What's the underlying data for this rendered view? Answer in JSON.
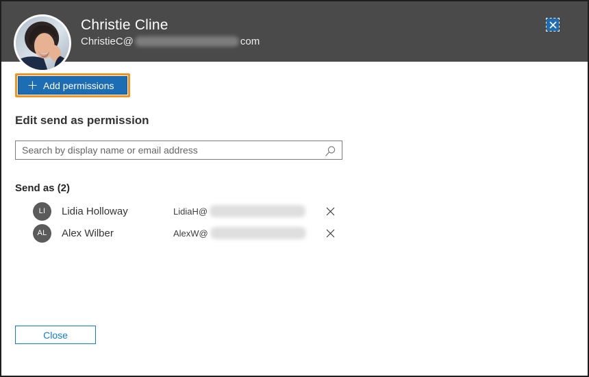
{
  "header": {
    "name": "Christie Cline",
    "email_prefix": "ChristieC@",
    "email_suffix": "com",
    "avatar_alt": "christie-cline-photo",
    "close_icon": "close-x"
  },
  "toolbar": {
    "add_permissions_label": "Add permissions",
    "plus_icon": "plus",
    "highlight_color": "#f2941f",
    "button_color": "#1d6db4"
  },
  "section": {
    "title": "Edit send as permission"
  },
  "search": {
    "placeholder": "Search by display name or email address",
    "icon": "magnifier"
  },
  "list": {
    "title": "Send as (2)",
    "rows": [
      {
        "initials": "LI",
        "name": "Lidia Holloway",
        "email_prefix": "LidiaH@",
        "remove_icon": "close-x"
      },
      {
        "initials": "AL",
        "name": "Alex Wilber",
        "email_prefix": "AlexW@",
        "remove_icon": "close-x"
      }
    ]
  },
  "footer": {
    "close_label": "Close"
  },
  "colors": {
    "header_bg": "#4a4a4a",
    "accent_blue": "#1d6db4",
    "close_button_blue": "#0f7cd4",
    "highlight_orange": "#f2941f",
    "avatar_gray": "#5b5b5b"
  }
}
